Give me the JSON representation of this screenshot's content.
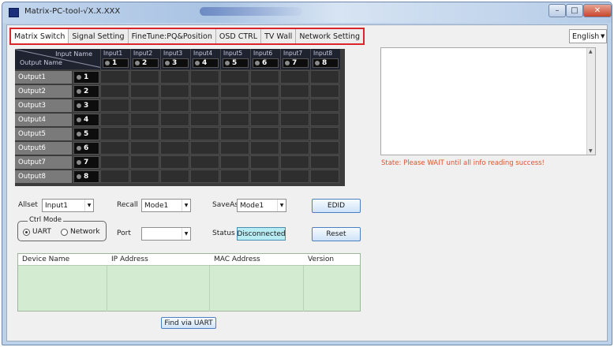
{
  "window": {
    "title": "Matrix-PC-tool-√X.X.XXX",
    "buttons": {
      "minimize": "–",
      "maximize": "□",
      "close": "✕"
    }
  },
  "tabs": [
    {
      "label": "Matrix Switch",
      "active": true
    },
    {
      "label": "Signal Setting"
    },
    {
      "label": "FineTune:PQ&Position"
    },
    {
      "label": "OSD CTRL"
    },
    {
      "label": "TV Wall"
    },
    {
      "label": "Network Setting"
    }
  ],
  "language": {
    "selected": "English"
  },
  "matrix": {
    "corner_input": "Input Name",
    "corner_output": "Output Name",
    "inputs": [
      {
        "label": "Input1",
        "num": "1"
      },
      {
        "label": "Input2",
        "num": "2"
      },
      {
        "label": "Input3",
        "num": "3"
      },
      {
        "label": "Input4",
        "num": "4"
      },
      {
        "label": "Input5",
        "num": "5"
      },
      {
        "label": "Input6",
        "num": "6"
      },
      {
        "label": "Input7",
        "num": "7"
      },
      {
        "label": "Input8",
        "num": "8"
      }
    ],
    "outputs": [
      {
        "label": "Output1",
        "num": "1"
      },
      {
        "label": "Output2",
        "num": "2"
      },
      {
        "label": "Output3",
        "num": "3"
      },
      {
        "label": "Output4",
        "num": "4"
      },
      {
        "label": "Output5",
        "num": "5"
      },
      {
        "label": "Output6",
        "num": "6"
      },
      {
        "label": "Output7",
        "num": "7"
      },
      {
        "label": "Output8",
        "num": "8"
      }
    ]
  },
  "info_panel": {
    "state_text": "State: Please WAIT until all info reading success!",
    "state_color": "#e0512f"
  },
  "controls": {
    "all_set_label": "Allset",
    "all_set_value": "Input1",
    "recall_label": "Recall",
    "recall_value": "Mode1",
    "save_as_label": "SaveAs",
    "save_as_value": "Mode1",
    "edid_button": "EDID",
    "ctrl_mode_label": "Ctrl Mode",
    "uart_label": "UART",
    "network_label": "Network",
    "port_label": "Port",
    "port_value": "",
    "status_label": "Status",
    "status_value": "Disconnected",
    "reset_button": "Reset"
  },
  "device_table": {
    "columns": [
      "Device Name",
      "IP Address",
      "MAC Address",
      "Version"
    ],
    "rows": []
  },
  "find_button": "Find via UART"
}
